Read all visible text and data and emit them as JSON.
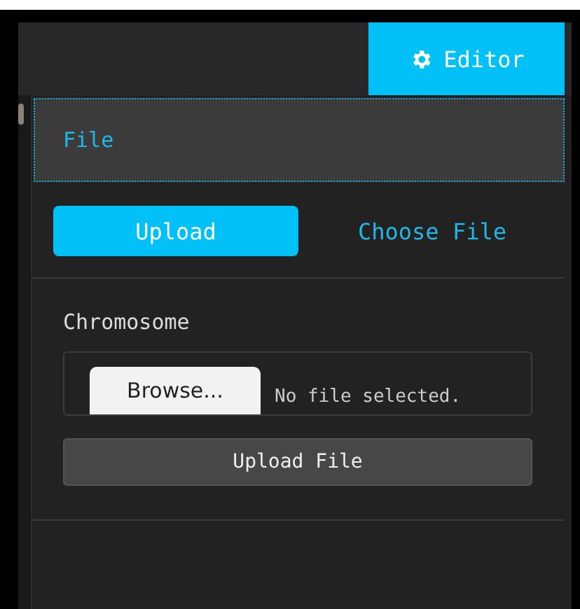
{
  "header": {
    "tabs": [
      {
        "label": "Editor",
        "selected": true
      }
    ]
  },
  "section": {
    "title": "File",
    "focused": true
  },
  "mode_tabs": [
    {
      "label": "Upload",
      "selected": true
    },
    {
      "label": "Choose File",
      "selected": false
    }
  ],
  "form": {
    "label": "Chromosome",
    "browse_button": "Browse...",
    "file_status": "No file selected.",
    "submit_button": "Upload File"
  }
}
